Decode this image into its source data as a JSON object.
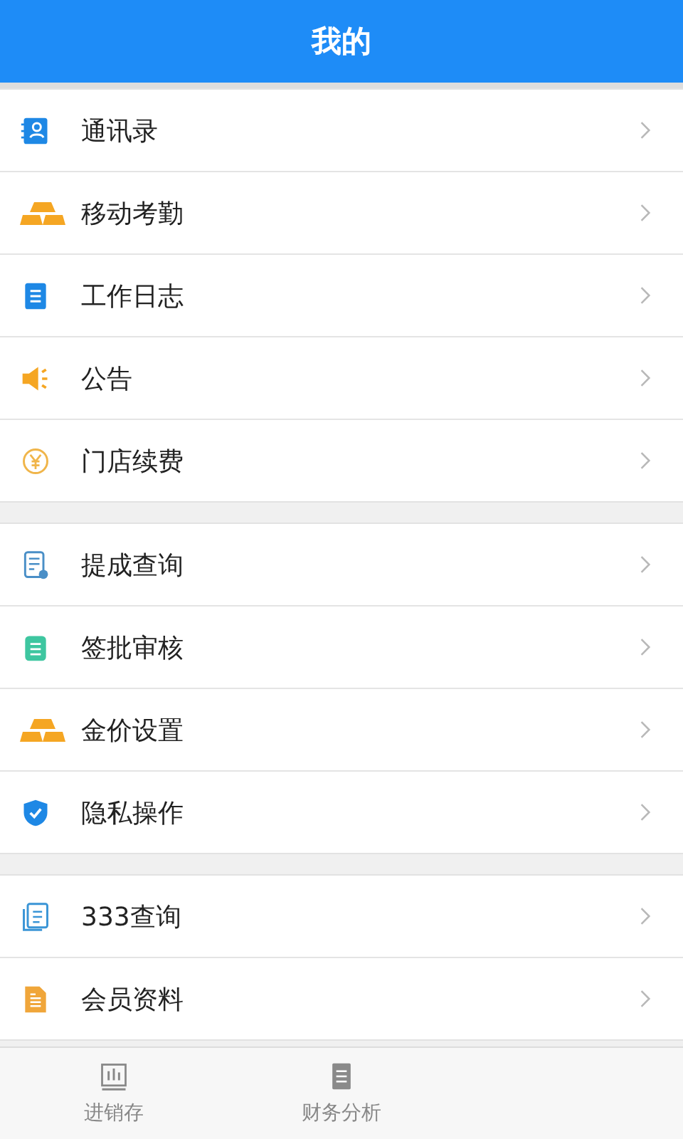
{
  "header": {
    "title": "我的"
  },
  "sections": [
    {
      "items": [
        {
          "label": "通讯录",
          "kind": "contacts"
        },
        {
          "label": "移动考勤",
          "kind": "gold"
        },
        {
          "label": "工作日志",
          "kind": "doc"
        },
        {
          "label": "公告",
          "kind": "speaker"
        },
        {
          "label": "门店续费",
          "kind": "yen"
        }
      ]
    },
    {
      "items": [
        {
          "label": "提成查询",
          "kind": "docsearch"
        },
        {
          "label": "签批审核",
          "kind": "clipboard"
        },
        {
          "label": "金价设置",
          "kind": "gold"
        },
        {
          "label": "隐私操作",
          "kind": "shield"
        }
      ]
    },
    {
      "items": [
        {
          "label": "333查询",
          "kind": "docs"
        },
        {
          "label": "会员资料",
          "kind": "file"
        }
      ]
    }
  ],
  "tabs": [
    {
      "label": "进销存",
      "kind": "chart",
      "selected": false
    },
    {
      "label": "财务分析",
      "kind": "book",
      "selected": false
    }
  ]
}
